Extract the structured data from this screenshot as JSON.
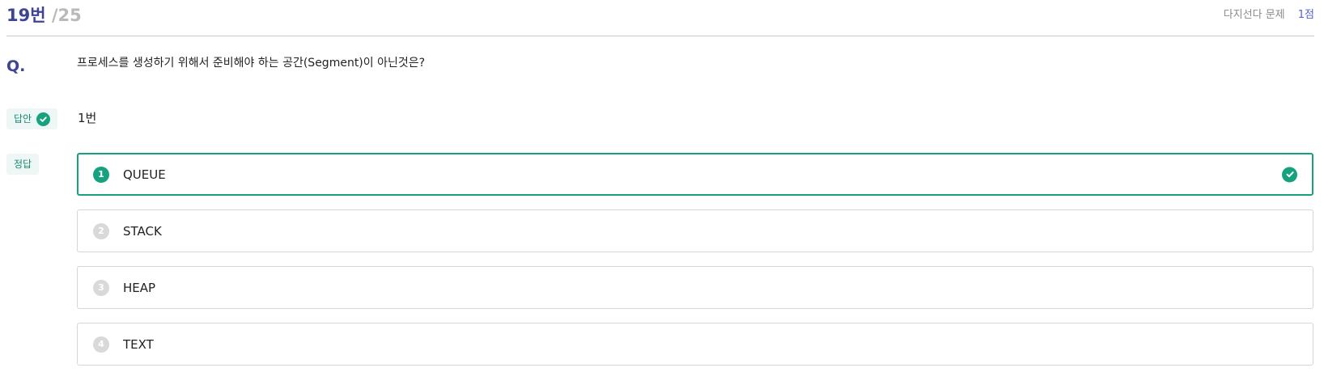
{
  "header": {
    "current": "19번",
    "total": "/25",
    "type": "다지선다 문제",
    "score": "1점"
  },
  "question": {
    "mark": "Q.",
    "text": "프로세스를 생성하기 위해서 준비해야 하는 공간(Segment)이 아닌것은?"
  },
  "answer": {
    "badge": "답안",
    "value": "1번"
  },
  "correct": {
    "badge": "정답"
  },
  "options": [
    {
      "num": "1",
      "label": "QUEUE",
      "selected": true
    },
    {
      "num": "2",
      "label": "STACK",
      "selected": false
    },
    {
      "num": "3",
      "label": "HEAP",
      "selected": false
    },
    {
      "num": "4",
      "label": "TEXT",
      "selected": false
    }
  ],
  "colors": {
    "accent": "#3d4494",
    "correct": "#16a27f",
    "muted": "#b9b9b9"
  },
  "icons": {
    "answer_check": "check-circle-icon",
    "option_check": "check-circle-icon"
  }
}
